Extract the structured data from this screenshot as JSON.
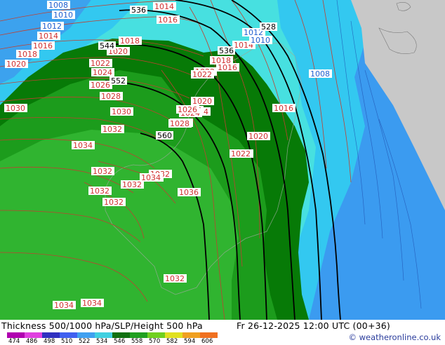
{
  "title": "Thickness 500/1000 hPa/SLP/Height 500 hPa",
  "datetime": "Fr 26-12-2025 12:00 UTC (00+36)",
  "credit": "© weatheronline.co.uk",
  "colors": {
    "ocean_far": "#3b9bf0",
    "ocean_mid": "#33c8f0",
    "ocean_near": "#47e0e0",
    "coast_cyan": "#6ef0f0",
    "dark_green": "#077a07",
    "mid_green": "#1c9c1c",
    "light_green": "#34b834",
    "land_grey": "#c8c8c8",
    "isobar": "#c04030",
    "height_contour": "#000000"
  },
  "legend_scale": {
    "values": [
      "474",
      "486",
      "498",
      "510",
      "522",
      "534",
      "546",
      "558",
      "570",
      "582",
      "594",
      "606"
    ],
    "colors": [
      "#b000b0",
      "#e040e0",
      "#3030c0",
      "#4060f0",
      "#40a0f0",
      "#40d0e0",
      "#107010",
      "#20a020",
      "#70d020",
      "#e0e020",
      "#f0a020",
      "#f07020"
    ]
  },
  "height_labels": [
    "536",
    "544",
    "552",
    "560",
    "528",
    "536"
  ],
  "isobar_labels": [
    "1008",
    "1010",
    "1012",
    "1014",
    "1016",
    "1018",
    "1020",
    "1022",
    "1024",
    "1026",
    "1028",
    "1030",
    "1032",
    "1034",
    "1014",
    "1016",
    "1018",
    "1020",
    "1022",
    "1024",
    "1026",
    "1028",
    "1030",
    "1032",
    "1034",
    "1036",
    "1012",
    "1014",
    "1010",
    "1008",
    "1016",
    "1018",
    "1016",
    "1022",
    "1020",
    "1022",
    "1024",
    "1026",
    "1028",
    "1020",
    "1022",
    "1032",
    "1034",
    "1032",
    "1032",
    "1034",
    "1032",
    "1036",
    "1032",
    "1034",
    "1034",
    "1022",
    "1020"
  ]
}
